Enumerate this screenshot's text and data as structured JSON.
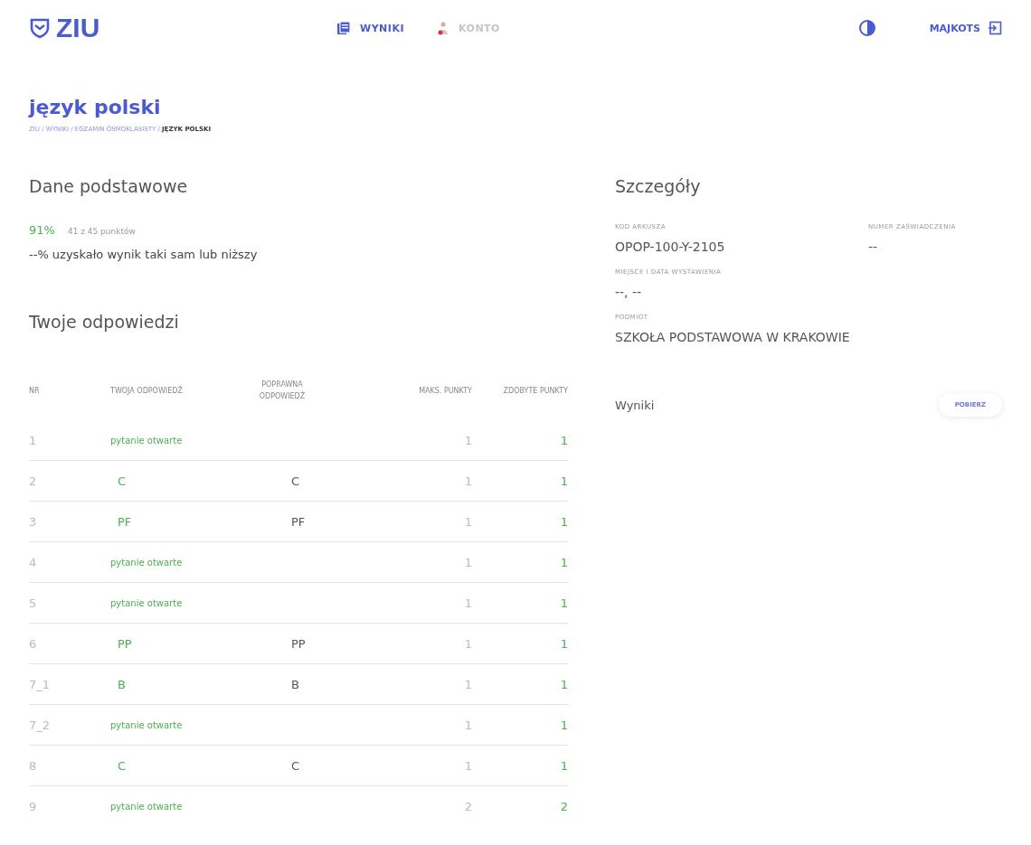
{
  "header": {
    "logo": "ZIU",
    "nav": [
      {
        "label": "WYNIKI",
        "selected": true
      },
      {
        "label": "KONTO",
        "selected": false
      }
    ],
    "user": "MAJKOTS"
  },
  "page": {
    "title": "język polski",
    "breadcrumb": "ZIU / WYNIKI / EGZAMIN ÓSMOKLASISTY / **JĘZYK POLSKI**"
  },
  "basic": {
    "heading": "Dane podstawowe",
    "percent": "91%",
    "points": "41 z 45 punktów",
    "percentile": "--% uzyskało wynik taki sam lub niższy"
  },
  "answers": {
    "heading": "Twoje odpowiedzi",
    "columns": [
      "NR",
      "TWOJA ODPOWIEDŹ",
      "POPRAWNA ODPOWIEDŹ",
      "MAKS. PUNKTY",
      "ZDOBYTE PUNKTY"
    ],
    "rows": [
      {
        "nr": "1",
        "answer": "pytanie otwarte",
        "kind": "open",
        "correct_answer": "",
        "max": "1",
        "earned": "1",
        "correct": true
      },
      {
        "nr": "2",
        "answer": "C",
        "kind": "closed",
        "correct_answer": "C",
        "max": "1",
        "earned": "1",
        "correct": true
      },
      {
        "nr": "3",
        "answer": "PF",
        "kind": "closed",
        "correct_answer": "PF",
        "max": "1",
        "earned": "1",
        "correct": true
      },
      {
        "nr": "4",
        "answer": "pytanie otwarte",
        "kind": "open",
        "correct_answer": "",
        "max": "1",
        "earned": "1",
        "correct": true
      },
      {
        "nr": "5",
        "answer": "pytanie otwarte",
        "kind": "open",
        "correct_answer": "",
        "max": "1",
        "earned": "1",
        "correct": true
      },
      {
        "nr": "6",
        "answer": "PP",
        "kind": "closed",
        "correct_answer": "PP",
        "max": "1",
        "earned": "1",
        "correct": true
      },
      {
        "nr": "7_1",
        "answer": "B",
        "kind": "closed",
        "correct_answer": "B",
        "max": "1",
        "earned": "1",
        "correct": true
      },
      {
        "nr": "7_2",
        "answer": "pytanie otwarte",
        "kind": "open",
        "correct_answer": "",
        "max": "1",
        "earned": "1",
        "correct": true
      },
      {
        "nr": "8",
        "answer": "C",
        "kind": "closed",
        "correct_answer": "C",
        "max": "1",
        "earned": "1",
        "correct": true
      },
      {
        "nr": "9",
        "answer": "pytanie otwarte",
        "kind": "open",
        "correct_answer": "",
        "max": "2",
        "earned": "2",
        "correct": true
      }
    ]
  },
  "details": {
    "heading": "Szczegóły",
    "fields": [
      {
        "label": "KOD ARKUSZA",
        "value": "OPOP-100-Y-2105"
      },
      {
        "label": "NUMER ZAŚWIADCZENIA",
        "value": "--"
      },
      {
        "label": "MIEJSCE I DATA WYSTAWIENIA",
        "value": "--, --"
      },
      {
        "label": "PODMIOT",
        "value": "SZKOŁA PODSTAWOWA W KRAKOWIE"
      }
    ],
    "download": {
      "label": "Wyniki",
      "button": "POBIERZ"
    }
  }
}
